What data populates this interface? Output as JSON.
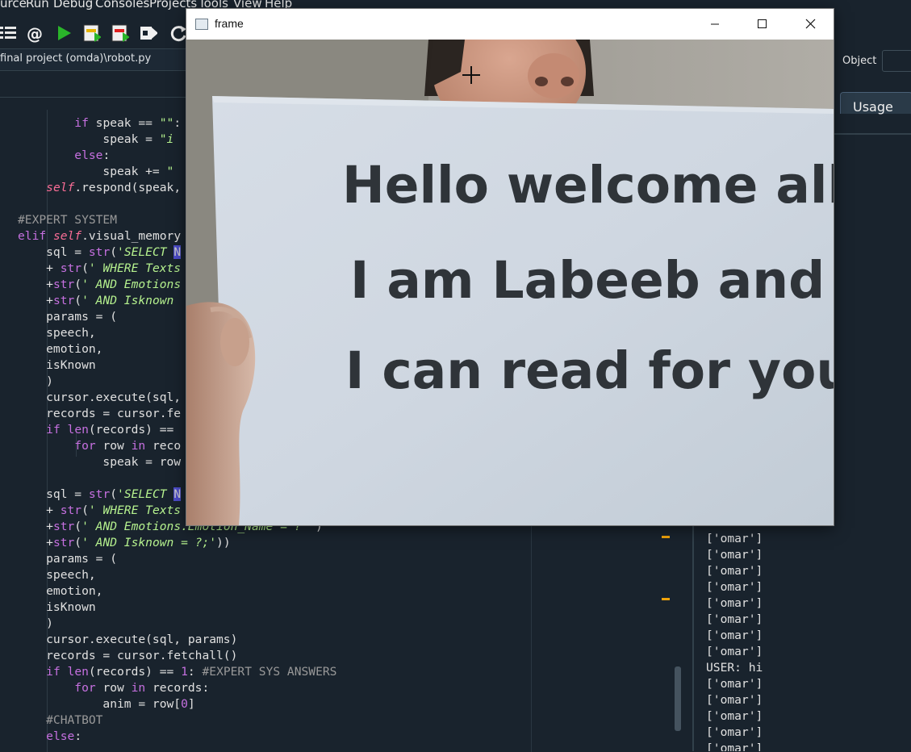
{
  "menu": {
    "source_label": "urce",
    "run_label": "Run",
    "debug_label": "Debug",
    "consoles_label": "Consoles",
    "projects_label": "Projects",
    "tools_label": "Tools",
    "view_label": "View",
    "help_label": "Help"
  },
  "toolbar": {
    "at_symbol": "@"
  },
  "file_path": "final project (omda)\\robot.py",
  "code_lines": {
    "l1": [
      {
        "t": "        ",
        "c": ""
      },
      {
        "t": "if",
        "c": "kw"
      },
      {
        "t": " speak == ",
        "c": ""
      },
      {
        "t": "\"\"",
        "c": "st"
      },
      {
        "t": ":",
        "c": ""
      }
    ],
    "l2": [
      {
        "t": "            speak = ",
        "c": ""
      },
      {
        "t": "\"i ",
        "c": "st"
      }
    ],
    "l3": [
      {
        "t": "        ",
        "c": ""
      },
      {
        "t": "else",
        "c": "kw"
      },
      {
        "t": ":",
        "c": ""
      }
    ],
    "l4": [
      {
        "t": "            speak += ",
        "c": ""
      },
      {
        "t": "\" ",
        "c": "st"
      }
    ],
    "l5": [
      {
        "t": "    ",
        "c": ""
      },
      {
        "t": "self",
        "c": "se"
      },
      {
        "t": ".respond(speak,",
        "c": ""
      }
    ],
    "l6": [],
    "l7": [
      {
        "t": "#EXPERT SYSTEM",
        "c": "cm"
      }
    ],
    "l8": [
      {
        "t": "elif",
        "c": "kw"
      },
      {
        "t": " ",
        "c": ""
      },
      {
        "t": "self",
        "c": "se"
      },
      {
        "t": ".visual_memory",
        "c": ""
      }
    ],
    "l9": [
      {
        "t": "    sql = ",
        "c": ""
      },
      {
        "t": "str",
        "c": "bi"
      },
      {
        "t": "(",
        "c": ""
      },
      {
        "t": "'SELECT ",
        "c": "st"
      },
      {
        "t": "N",
        "c": "hl"
      }
    ],
    "l10": [
      {
        "t": "    + ",
        "c": ""
      },
      {
        "t": "str",
        "c": "bi"
      },
      {
        "t": "(",
        "c": ""
      },
      {
        "t": "' WHERE Texts",
        "c": "st"
      }
    ],
    "l11": [
      {
        "t": "    +",
        "c": ""
      },
      {
        "t": "str",
        "c": "bi"
      },
      {
        "t": "(",
        "c": ""
      },
      {
        "t": "' AND Emotions",
        "c": "st"
      }
    ],
    "l12": [
      {
        "t": "    +",
        "c": ""
      },
      {
        "t": "str",
        "c": "bi"
      },
      {
        "t": "(",
        "c": ""
      },
      {
        "t": "' AND Isknown ",
        "c": "st"
      }
    ],
    "l13": [
      {
        "t": "    params = (",
        "c": ""
      }
    ],
    "l14": [
      {
        "t": "    speech,",
        "c": ""
      }
    ],
    "l15": [
      {
        "t": "    emotion,",
        "c": ""
      }
    ],
    "l16": [
      {
        "t": "    isKnown",
        "c": ""
      }
    ],
    "l17": [
      {
        "t": "    )",
        "c": ""
      }
    ],
    "l18": [
      {
        "t": "    cursor.execute(sql,",
        "c": ""
      }
    ],
    "l19": [
      {
        "t": "    records = cursor.fe",
        "c": ""
      }
    ],
    "l20": [
      {
        "t": "    ",
        "c": ""
      },
      {
        "t": "if",
        "c": "kw"
      },
      {
        "t": " ",
        "c": ""
      },
      {
        "t": "len",
        "c": "bi"
      },
      {
        "t": "(records) ==",
        "c": ""
      }
    ],
    "l21": [
      {
        "t": "        ",
        "c": ""
      },
      {
        "t": "for",
        "c": "kw"
      },
      {
        "t": " row ",
        "c": ""
      },
      {
        "t": "in",
        "c": "kw"
      },
      {
        "t": " reco",
        "c": ""
      }
    ],
    "l22": [
      {
        "t": "            speak = row",
        "c": ""
      }
    ],
    "l23": [],
    "l24": [
      {
        "t": "    sql = ",
        "c": ""
      },
      {
        "t": "str",
        "c": "bi"
      },
      {
        "t": "(",
        "c": ""
      },
      {
        "t": "'SELECT ",
        "c": "st"
      },
      {
        "t": "N",
        "c": "hl"
      }
    ],
    "l25": [
      {
        "t": "    + ",
        "c": ""
      },
      {
        "t": "str",
        "c": "bi"
      },
      {
        "t": "(",
        "c": ""
      },
      {
        "t": "' WHERE Texts",
        "c": "st"
      }
    ],
    "l26": [
      {
        "t": "    +",
        "c": ""
      },
      {
        "t": "str",
        "c": "bi"
      },
      {
        "t": "(",
        "c": ""
      },
      {
        "t": "' AND Emotions.Emotion_Name = ? '",
        "c": "st"
      },
      {
        "t": ")",
        "c": ""
      }
    ],
    "l27": [
      {
        "t": "    +",
        "c": ""
      },
      {
        "t": "str",
        "c": "bi"
      },
      {
        "t": "(",
        "c": ""
      },
      {
        "t": "' AND Isknown = ?;'",
        "c": "st"
      },
      {
        "t": "))",
        "c": ""
      }
    ],
    "l28": [
      {
        "t": "    params = (",
        "c": ""
      }
    ],
    "l29": [
      {
        "t": "    speech,",
        "c": ""
      }
    ],
    "l30": [
      {
        "t": "    emotion,",
        "c": ""
      }
    ],
    "l31": [
      {
        "t": "    isKnown",
        "c": ""
      }
    ],
    "l32": [
      {
        "t": "    )",
        "c": ""
      }
    ],
    "l33": [
      {
        "t": "    cursor.execute(sql, params)",
        "c": ""
      }
    ],
    "l34": [
      {
        "t": "    records = cursor.fetchall()",
        "c": ""
      }
    ],
    "l35": [
      {
        "t": "    ",
        "c": ""
      },
      {
        "t": "if",
        "c": "kw"
      },
      {
        "t": " ",
        "c": ""
      },
      {
        "t": "len",
        "c": "bi"
      },
      {
        "t": "(records) == ",
        "c": ""
      },
      {
        "t": "1",
        "c": "bi"
      },
      {
        "t": ": ",
        "c": ""
      },
      {
        "t": "#EXPERT SYS ANSWERS",
        "c": "cm"
      }
    ],
    "l36": [
      {
        "t": "        ",
        "c": ""
      },
      {
        "t": "for",
        "c": "kw"
      },
      {
        "t": " row ",
        "c": ""
      },
      {
        "t": "in",
        "c": "kw"
      },
      {
        "t": " records:",
        "c": ""
      }
    ],
    "l37": [
      {
        "t": "            anim = row[",
        "c": ""
      },
      {
        "t": "0",
        "c": "bi"
      },
      {
        "t": "]",
        "c": ""
      }
    ],
    "l38": [
      {
        "t": "    #CHATBOT",
        "c": "cm"
      }
    ],
    "l39": [
      {
        "t": "    ",
        "c": ""
      },
      {
        "t": "else",
        "c": "kw"
      },
      {
        "t": ":",
        "c": ""
      }
    ]
  },
  "right_panel": {
    "object_label": "Object",
    "usage_tab": "Usage"
  },
  "console": {
    "partial_top": "['omar']",
    "lines": [
      "['omar']",
      "['omar']",
      "['omar']",
      "['omar']",
      "['omar']",
      "['omar']",
      "['omar']",
      "['omar']",
      "USER: hi",
      "['omar']",
      "['omar']",
      "['omar']",
      "['omar']",
      "['omar']"
    ]
  },
  "frame_window": {
    "title": "frame",
    "sign_lines": [
      "Hello welcome all",
      "I am  Labeeb and",
      "I can read for you"
    ]
  },
  "colors": {
    "ide_background": "#19232d",
    "keyword": "#c670e0",
    "string": "#b5f18e",
    "self": "#fa6d96",
    "comment": "#999999",
    "warning_marker": "#f0a30a"
  }
}
